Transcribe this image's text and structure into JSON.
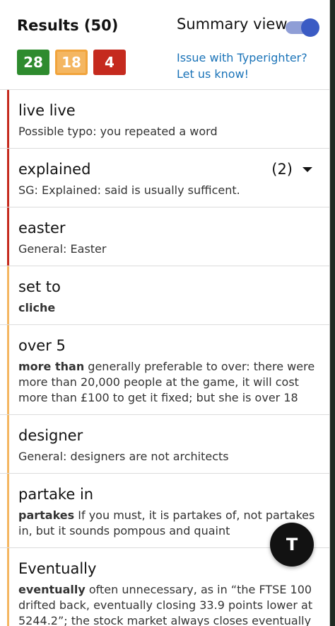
{
  "header": {
    "results_title": "Results (50)",
    "summary_label": "Summary view",
    "summary_enabled": true,
    "badges": [
      {
        "value": "28",
        "color": "#2e8b2e"
      },
      {
        "value": "18",
        "color": "#f4b661"
      },
      {
        "value": "4",
        "color": "#c52a1e"
      }
    ],
    "issue_line1": "Issue with Typerighter?",
    "issue_line2": "Let us know!"
  },
  "items": [
    {
      "title": "live live",
      "desc": "Possible typo: you repeated a word"
    },
    {
      "title": "explained",
      "count": "(2)",
      "desc": "SG: Explained: said is usually sufficent."
    },
    {
      "title": "easter",
      "desc": "General: Easter"
    },
    {
      "title": "set to",
      "bold": "cliche"
    },
    {
      "title": "over 5",
      "bold": "more than",
      "desc": "generally preferable to over: there were more than 20,000 people at the game, it will cost more than £100 to get it fixed; but she is over 18"
    },
    {
      "title": "designer",
      "desc": "General: designers are not architects"
    },
    {
      "title": "partake in",
      "bold": "partakes",
      "desc": "If you must, it is partakes of, not partakes in, but it sounds pompous and quaint"
    },
    {
      "title": "Eventually",
      "bold": "eventually",
      "desc": "often unnecessary, as in “the FTSE 100 drifted back, eventually closing 33.9 points lower at 5244.2”; the stock market always closes eventually"
    }
  ],
  "fab_label": "T",
  "colors": {
    "red": "#c52a1e",
    "amber": "#f4b661",
    "green": "#2e8b2e",
    "link": "#1a73b8"
  },
  "icons": {
    "dropdown": "chevron-down-icon",
    "toggle": "toggle-switch"
  }
}
